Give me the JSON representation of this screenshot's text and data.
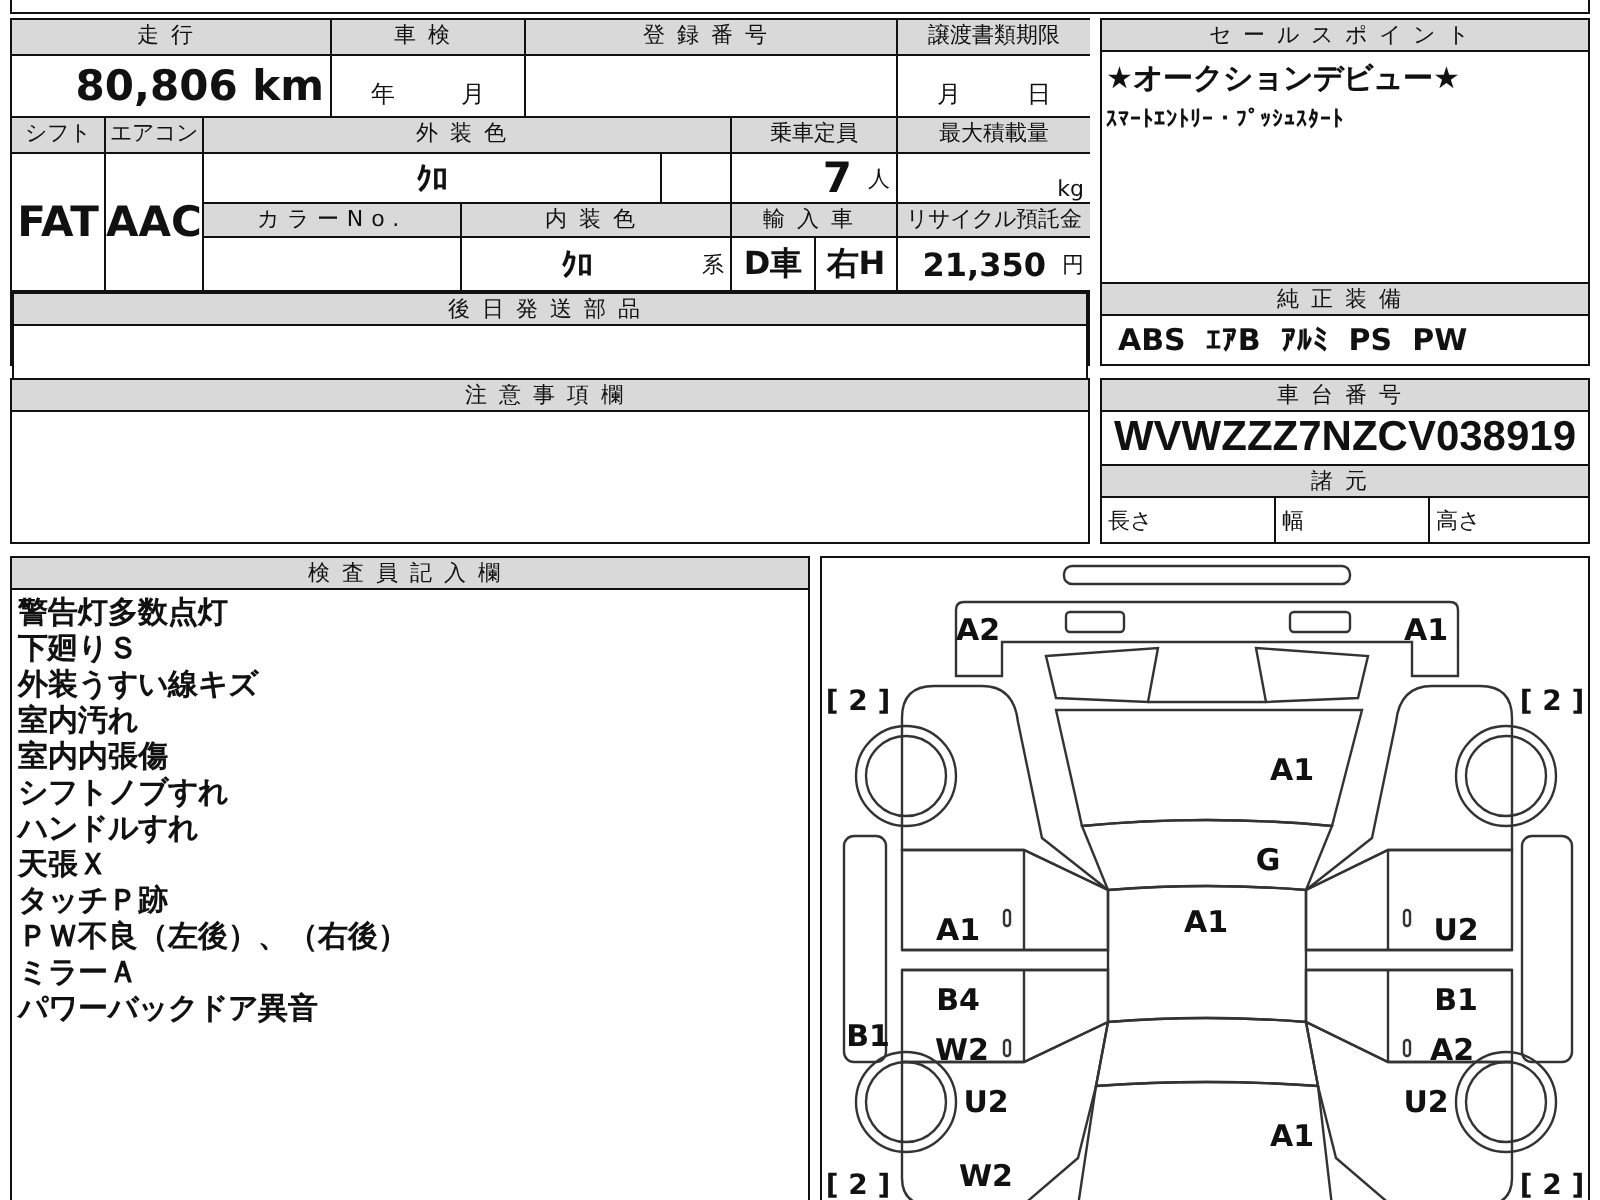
{
  "vehicle_table": {
    "mileage": {
      "label": "走行",
      "value": "80,806",
      "unit": "km"
    },
    "inspection": {
      "label": "車検",
      "year_unit": "年",
      "month_unit": "月"
    },
    "registration_number": {
      "label": "登録番号"
    },
    "transfer_deadline": {
      "label": "譲渡書類期限",
      "month_unit": "月",
      "day_unit": "日"
    },
    "shift": {
      "label": "シフト",
      "value": "FAT"
    },
    "air_conditioner": {
      "label": "エアコン",
      "value": "AAC"
    },
    "exterior_color": {
      "label": "外装色",
      "value": "ｸﾛ"
    },
    "capacity": {
      "label": "乗車定員",
      "value": "7",
      "unit": "人"
    },
    "max_load": {
      "label": "最大積載量",
      "unit": "kg"
    },
    "color_number": {
      "label": "カラーNo."
    },
    "interior_color": {
      "label": "内装色",
      "value": "ｸﾛ",
      "suffix": "系"
    },
    "import": {
      "label": "輸入車",
      "dealer": "D車",
      "steering": "右H"
    },
    "recycling_fee": {
      "label": "リサイクル預託金",
      "value": "21,350",
      "unit": "円"
    }
  },
  "parts_shipped_later": {
    "label": "後日発送部品"
  },
  "notes": {
    "label": "注意事項欄"
  },
  "sales_points": {
    "label": "セールスポイント",
    "lines": [
      "★オークションデビュー★",
      "ｽﾏｰﾄｴﾝﾄﾘｰ・ﾌﾟｯｼｭｽﾀｰﾄ"
    ]
  },
  "standard_equipment": {
    "label": "純正装備",
    "items": [
      "ABS",
      "ｴｱB",
      "ｱﾙﾐ",
      "PS",
      "PW"
    ]
  },
  "chassis_number": {
    "label": "車台番号",
    "value": "WVWZZZ7NZCV038919"
  },
  "specifications": {
    "label": "諸元",
    "fields": [
      "長さ",
      "幅",
      "高さ"
    ]
  },
  "inspector_notes": {
    "label": "検査員記入欄",
    "lines": [
      "警告灯多数点灯",
      "下廻りＳ",
      "外装うすい線キズ",
      "室内汚れ",
      "室内内張傷",
      "シフトノブすれ",
      "ハンドルすれ",
      "天張Ｘ",
      "タッチＰ跡",
      "ＰＷ不良（左後）、（右後）",
      "ミラーＡ",
      "パワーバックドア異音"
    ]
  },
  "damage_diagram": {
    "tire_marks": [
      "[ 2 ]",
      "[ 2 ]",
      "[ 2 ]",
      "[ 2 ]"
    ],
    "marks": [
      "A2",
      "A1",
      "A1",
      "G",
      "A1",
      "A1",
      "U2",
      "B4",
      "B1",
      "B1",
      "W2",
      "A2",
      "U2",
      "U2",
      "A1",
      "W2"
    ]
  }
}
